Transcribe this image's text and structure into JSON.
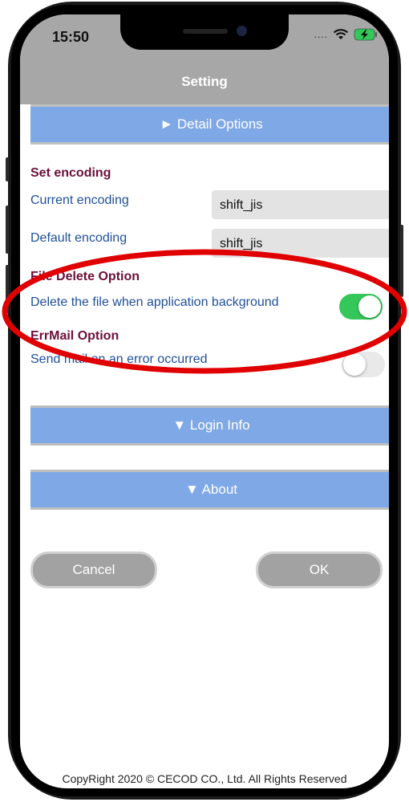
{
  "status_bar": {
    "time": "15:50",
    "signal": "....",
    "wifi_icon": "wifi-icon",
    "battery_icon": "battery-charging-icon"
  },
  "header": {
    "title": "Setting"
  },
  "detail_options": {
    "label": "► Detail Options"
  },
  "encoding": {
    "section_title": "Set encoding",
    "current_label": "Current encoding",
    "current_value": "shift_jis",
    "default_label": "Default encoding",
    "default_value": "shift_jis"
  },
  "file_delete": {
    "section_title": "File Delete Option",
    "label": "Delete the file when application background",
    "enabled": true
  },
  "errmail": {
    "section_title": "ErrMail Option",
    "label": "Send mail on an error occurred",
    "enabled": false
  },
  "login_info": {
    "label": "▼ Login Info"
  },
  "about": {
    "label": "▼ About"
  },
  "buttons": {
    "cancel": "Cancel",
    "ok": "OK"
  },
  "footer": {
    "copyright": "CopyRight 2020 © CECOD CO., Ltd. All Rights Reserved"
  },
  "colors": {
    "accent_bar": "#7fa8e6",
    "section_title": "#6b0f3a",
    "label": "#1f4f9a",
    "toggle_on": "#34c759",
    "annotation": "#e00000"
  }
}
